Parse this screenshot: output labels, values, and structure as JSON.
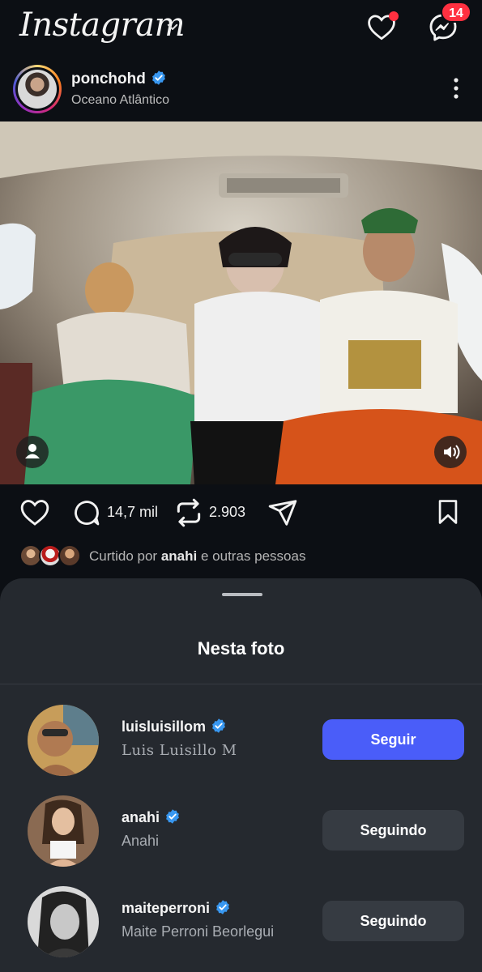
{
  "header": {
    "logo_text": "Instagram",
    "messenger_badge": "14"
  },
  "post": {
    "username": "ponchohd",
    "location": "Oceano Atlântico",
    "comments_count": "14,7 mil",
    "reposts_count": "2.903",
    "liked_by_prefix": "Curtido por",
    "liked_by_user": "anahi",
    "liked_by_suffix": "e outras pessoas"
  },
  "sheet": {
    "title": "Nesta foto",
    "people": [
      {
        "username": "luisluisillom",
        "full_name": "Luis Luisillo M",
        "button": "Seguir"
      },
      {
        "username": "anahi",
        "full_name": "Anahi",
        "button": "Seguindo"
      },
      {
        "username": "maiteperroni",
        "full_name": "Maite Perroni Beorlegui",
        "button": "Seguindo"
      }
    ]
  },
  "colors": {
    "background": "#0c0f14",
    "sheet": "#25292f",
    "follow_button": "#4a5df9",
    "following_button": "#363b42",
    "verified": "#3897f0",
    "notification": "#ff3040"
  },
  "icons": [
    "chevron-down-icon",
    "heart-icon",
    "messenger-icon",
    "verified-icon",
    "more-icon",
    "person-tag-icon",
    "speaker-icon",
    "comment-icon",
    "repost-icon",
    "share-icon",
    "bookmark-icon"
  ]
}
